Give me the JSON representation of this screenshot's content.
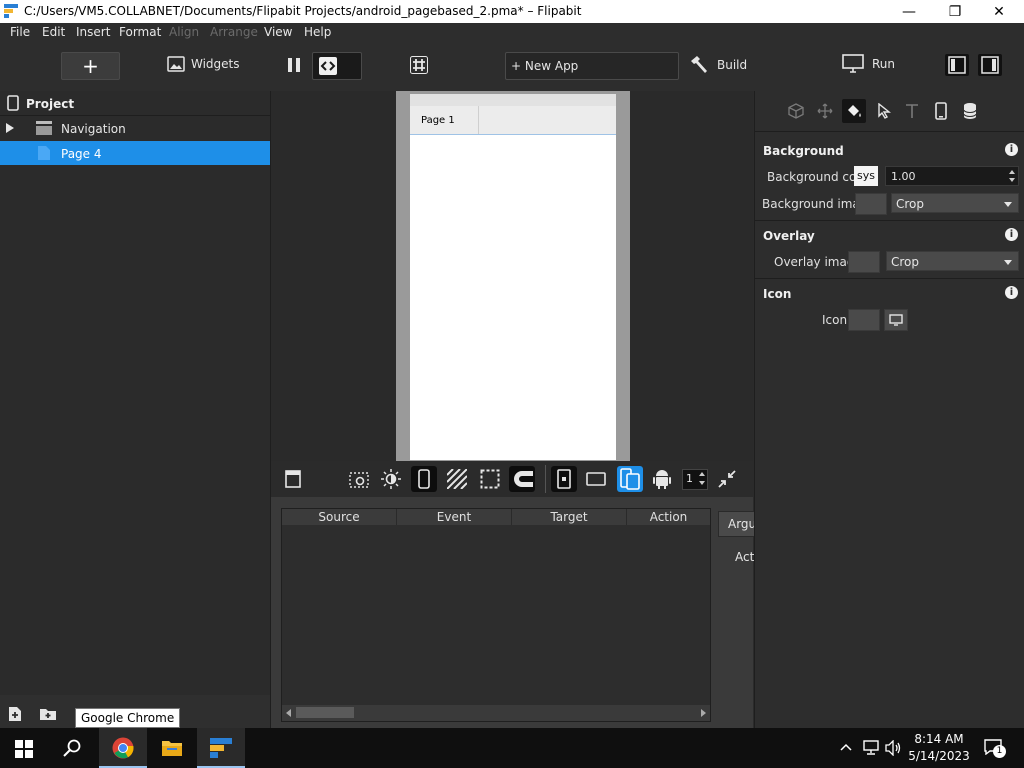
{
  "window": {
    "title": "C:/Users/VM5.COLLABNET/Documents/Flipabit Projects/android_pagebased_2.pma* – Flipabit",
    "minimize_glyph": "—",
    "maximize_glyph": "❐",
    "close_glyph": "✕"
  },
  "menu": {
    "file": "File",
    "edit": "Edit",
    "insert": "Insert",
    "format": "Format",
    "align": "Align",
    "arrange": "Arrange",
    "view": "View",
    "help": "Help"
  },
  "toolbar": {
    "add_glyph": "+",
    "widgets_label": "Widgets",
    "new_app_label": "+ New App",
    "build_label": "Build",
    "run_label": "Run"
  },
  "project": {
    "header": "Project",
    "items": [
      {
        "label": "Navigation"
      },
      {
        "label": "Page 4"
      }
    ]
  },
  "canvas": {
    "page_tab": "Page 1"
  },
  "device_toolbar": {
    "spin_value": "1"
  },
  "events": {
    "columns": [
      "Source",
      "Event",
      "Target",
      "Action"
    ],
    "side_tab_label": "Argu",
    "side_label": "Act"
  },
  "properties": {
    "background": {
      "title": "Background",
      "color_label": "Background color",
      "color_value": "sys",
      "opacity_value": "1.00",
      "image_label": "Background image",
      "image_mode": "Crop"
    },
    "overlay": {
      "title": "Overlay",
      "image_label": "Overlay image",
      "image_mode": "Crop"
    },
    "icon": {
      "title": "Icon",
      "icon_label": "Icon"
    }
  },
  "taskbar": {
    "tooltip": "Google Chrome",
    "time": "8:14 AM",
    "date": "5/14/2023",
    "notification_count": "1"
  },
  "colors": {
    "accent": "#1e8fe8",
    "panel": "#2d2d2d",
    "canvas": "#2a2a2a"
  }
}
